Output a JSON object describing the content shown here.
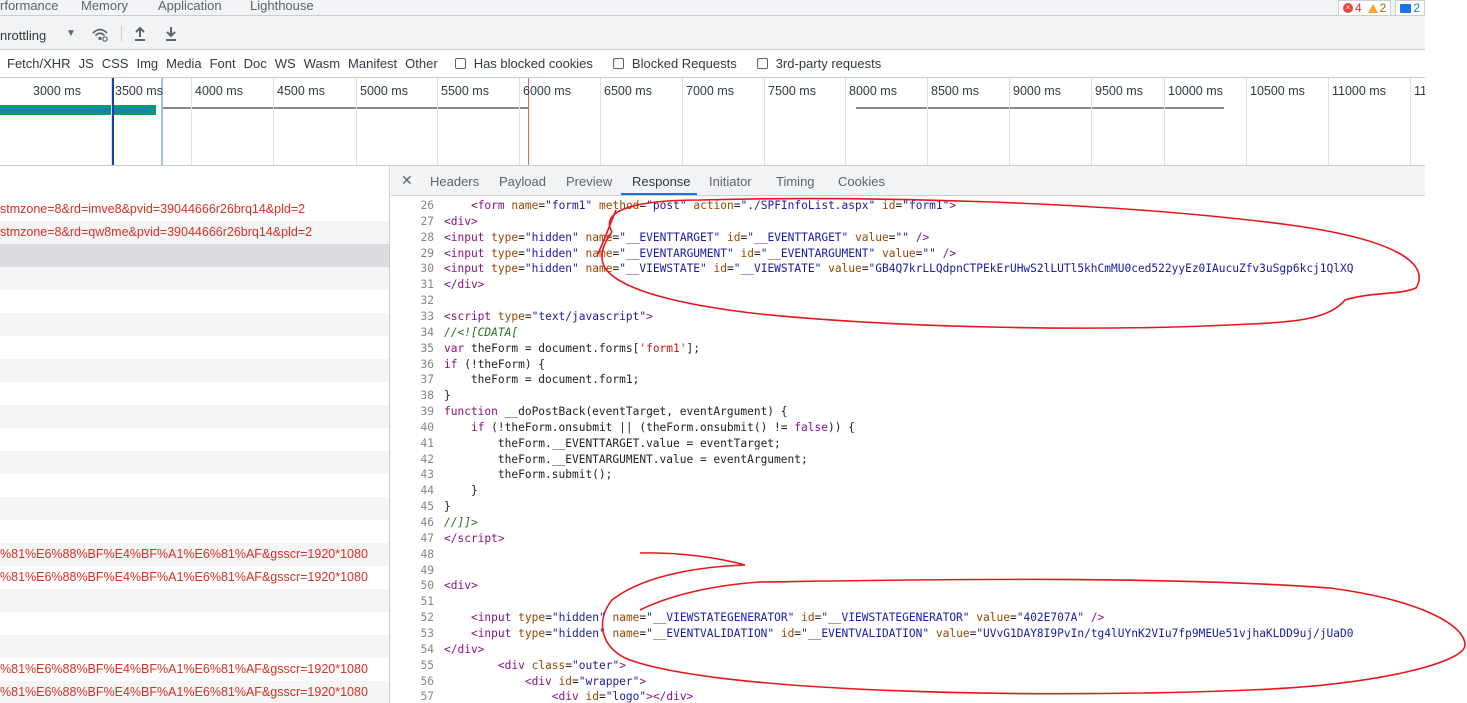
{
  "top_tabs": [
    "rformance",
    "Memory",
    "Application",
    "Lighthouse"
  ],
  "counters": {
    "errors": "4",
    "warnings": "2",
    "messages": "2"
  },
  "toolbar": {
    "throttling": "nrottling"
  },
  "filters": {
    "types": [
      "Fetch/XHR",
      "JS",
      "CSS",
      "Img",
      "Media",
      "Font",
      "Doc",
      "WS",
      "Wasm",
      "Manifest",
      "Other"
    ],
    "checkboxes": [
      "Has blocked cookies",
      "Blocked Requests",
      "3rd-party requests"
    ]
  },
  "timeline": {
    "ticks": [
      "3000 ms",
      "3500 ms",
      "4000 ms",
      "4500 ms",
      "5000 ms",
      "5500 ms",
      "6000 ms",
      "6500 ms",
      "7000 ms",
      "7500 ms",
      "8000 ms",
      "8500 ms",
      "9000 ms",
      "9500 ms",
      "10000 ms",
      "10500 ms",
      "11000 ms",
      "11"
    ]
  },
  "requests": [
    "stmzone=8&rd=imve8&pvid=39044666r26brq14&pld=2",
    "stmzone=8&rd=qw8me&pvid=39044666r26brq14&pld=2",
    "",
    "",
    "",
    "",
    "",
    "",
    "",
    "",
    "",
    "",
    "",
    "",
    "",
    "%81%E6%88%BF%E4%BF%A1%E6%81%AF&gsscr=1920*1080",
    "%81%E6%88%BF%E4%BF%A1%E6%81%AF&gsscr=1920*1080",
    "",
    "",
    "",
    "%81%E6%88%BF%E4%BF%A1%E6%81%AF&gsscr=1920*1080",
    "%81%E6%88%BF%E4%BF%A1%E6%81%AF&gsscr=1920*1080",
    ""
  ],
  "detail_tabs": [
    "Headers",
    "Payload",
    "Preview",
    "Response",
    "Initiator",
    "Timing",
    "Cookies"
  ],
  "active_tab": "Response",
  "code_lines": [
    {
      "n": "26",
      "html": "    <span class=\"t-tag\">&lt;form</span> <span class=\"t-attr\">name</span>=<span class=\"t-val\">\"form1\"</span> <span class=\"t-attr\">method</span>=<span class=\"t-val\">\"post\"</span> <span class=\"t-attr\">action</span>=<span class=\"t-val\">\"./SPFInfoList.aspx\"</span> <span class=\"t-attr\">id</span>=<span class=\"t-val\">\"form1\"</span><span class=\"t-tag\">&gt;</span>"
    },
    {
      "n": "27",
      "html": "<span class=\"t-tag\">&lt;div&gt;</span>"
    },
    {
      "n": "28",
      "html": "<span class=\"t-tag\">&lt;input</span> <span class=\"t-attr\">type</span>=<span class=\"t-val\">\"hidden\"</span> <span class=\"t-attr\">name</span>=<span class=\"t-val\">\"__EVENTTARGET\"</span> <span class=\"t-attr\">id</span>=<span class=\"t-val\">\"__EVENTTARGET\"</span> <span class=\"t-attr\">value</span>=<span class=\"t-val\">\"\"</span> <span class=\"t-tag\">/&gt;</span>"
    },
    {
      "n": "29",
      "html": "<span class=\"t-tag\">&lt;input</span> <span class=\"t-attr\">type</span>=<span class=\"t-val\">\"hidden\"</span> <span class=\"t-attr\">name</span>=<span class=\"t-val\">\"__EVENTARGUMENT\"</span> <span class=\"t-attr\">id</span>=<span class=\"t-val\">\"__EVENTARGUMENT\"</span> <span class=\"t-attr\">value</span>=<span class=\"t-val\">\"\"</span> <span class=\"t-tag\">/&gt;</span>"
    },
    {
      "n": "30",
      "html": "<span class=\"t-tag\">&lt;input</span> <span class=\"t-attr\">type</span>=<span class=\"t-val\">\"hidden\"</span> <span class=\"t-attr\">name</span>=<span class=\"t-val\">\"__VIEWSTATE\"</span> <span class=\"t-attr\">id</span>=<span class=\"t-val\">\"__VIEWSTATE\"</span> <span class=\"t-attr\">value</span>=<span class=\"t-val\">\"GB4Q7krLLQdpnCTPEkErUHwS2lLUTl5khCmMU0ced522yyEz0IAucuZfv3uSgp6kcj1QlXQ</span>"
    },
    {
      "n": "31",
      "html": "<span class=\"t-tag\">&lt;/div&gt;</span>"
    },
    {
      "n": "32",
      "html": ""
    },
    {
      "n": "33",
      "html": "<span class=\"t-tag\">&lt;script</span> <span class=\"t-attr\">type</span>=<span class=\"t-val\">\"text/javascript\"</span><span class=\"t-tag\">&gt;</span>"
    },
    {
      "n": "34",
      "html": "<span class=\"t-com\">//&lt;![CDATA[</span>"
    },
    {
      "n": "35",
      "html": "<span class=\"t-kw\">var</span> theForm = document.forms[<span class=\"t-str\">'form1'</span>];"
    },
    {
      "n": "36",
      "html": "<span class=\"t-kw\">if</span> (!theForm) {"
    },
    {
      "n": "37",
      "html": "    theForm = document.form1;"
    },
    {
      "n": "38",
      "html": "}"
    },
    {
      "n": "39",
      "html": "<span class=\"t-kw\">function</span> __doPostBack(eventTarget, eventArgument) {"
    },
    {
      "n": "40",
      "html": "    <span class=\"t-kw\">if</span> (!theForm.onsubmit || (theForm.onsubmit() != <span class=\"t-kw\">false</span>)) {"
    },
    {
      "n": "41",
      "html": "        theForm.__EVENTTARGET.value = eventTarget;"
    },
    {
      "n": "42",
      "html": "        theForm.__EVENTARGUMENT.value = eventArgument;"
    },
    {
      "n": "43",
      "html": "        theForm.submit();"
    },
    {
      "n": "44",
      "html": "    }"
    },
    {
      "n": "45",
      "html": "}"
    },
    {
      "n": "46",
      "html": "<span class=\"t-com\">//]]&gt;</span>"
    },
    {
      "n": "47",
      "html": "<span class=\"t-tag\">&lt;/script&gt;</span>"
    },
    {
      "n": "48",
      "html": ""
    },
    {
      "n": "49",
      "html": ""
    },
    {
      "n": "50",
      "html": "<span class=\"t-tag\">&lt;div&gt;</span>"
    },
    {
      "n": "51",
      "html": ""
    },
    {
      "n": "52",
      "html": "    <span class=\"t-tag\">&lt;input</span> <span class=\"t-attr\">type</span>=<span class=\"t-val\">\"hidden\"</span> <span class=\"t-attr\">name</span>=<span class=\"t-val\">\"__VIEWSTATEGENERATOR\"</span> <span class=\"t-attr\">id</span>=<span class=\"t-val\">\"__VIEWSTATEGENERATOR\"</span> <span class=\"t-attr\">value</span>=<span class=\"t-val\">\"402E707A\"</span> <span class=\"t-tag\">/&gt;</span>"
    },
    {
      "n": "53",
      "html": "    <span class=\"t-tag\">&lt;input</span> <span class=\"t-attr\">type</span>=<span class=\"t-val\">\"hidden\"</span> <span class=\"t-attr\">name</span>=<span class=\"t-val\">\"__EVENTVALIDATION\"</span> <span class=\"t-attr\">id</span>=<span class=\"t-val\">\"__EVENTVALIDATION\"</span> <span class=\"t-attr\">value</span>=<span class=\"t-val\">\"UVvG1DAY8I9PvIn/tg4lUYnK2VIu7fp9MEUe51vjhaKLDD9uj/jUaD0</span>"
    },
    {
      "n": "54",
      "html": "<span class=\"t-tag\">&lt;/div&gt;</span>"
    },
    {
      "n": "55",
      "html": "        <span class=\"t-tag\">&lt;div</span> <span class=\"t-attr\">class</span>=<span class=\"t-val\">\"outer\"</span><span class=\"t-tag\">&gt;</span>"
    },
    {
      "n": "56",
      "html": "            <span class=\"t-tag\">&lt;div</span> <span class=\"t-attr\">id</span>=<span class=\"t-val\">\"wrapper\"</span><span class=\"t-tag\">&gt;</span>"
    },
    {
      "n": "57",
      "html": "                <span class=\"t-tag\">&lt;div</span> <span class=\"t-attr\">id</span>=<span class=\"t-val\">\"logo\"</span><span class=\"t-tag\">&gt;&lt;/div&gt;</span>"
    }
  ]
}
